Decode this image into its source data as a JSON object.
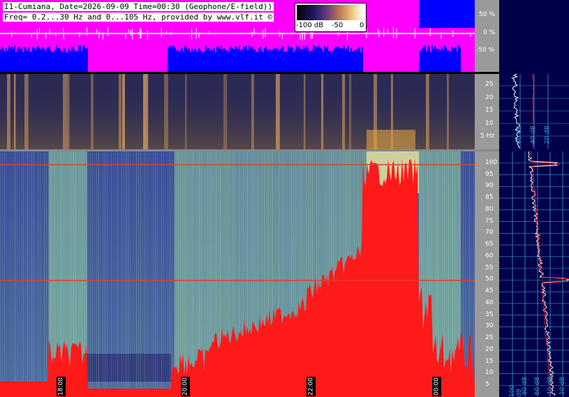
{
  "header": {
    "title_line1": "I1-Cumiana, Date=2026-09-09 Time=00:30 (Geophone/E-field))",
    "title_line2": "Freq= 0.2...30 Hz and 0...105 Hz, provided by www.vlf.it ©"
  },
  "colorbar": {
    "min_label": "-100 dB",
    "mid_label": "-50",
    "max_label": "0"
  },
  "top_panel": {
    "percent_labels": [
      "50 %",
      "0 %",
      "-50 %"
    ],
    "colors": {
      "background": "#ff00ff",
      "signal": "#0000ff",
      "baseline": "#ffffff"
    }
  },
  "middle_panel": {
    "freq_ticks": [
      "25",
      "20",
      "15",
      "10",
      "5 Hz"
    ]
  },
  "bottom_panel": {
    "freq_ticks": [
      "100",
      "95",
      "90",
      "85",
      "80",
      "75",
      "70",
      "65",
      "60",
      "55",
      "50",
      "45",
      "40",
      "35",
      "30",
      "25",
      "20",
      "15",
      "10",
      "5"
    ],
    "marker_lines_hz": [
      100,
      50
    ]
  },
  "time_labels": [
    "18:00",
    "20:00",
    "22:00",
    "00:00"
  ],
  "side_panel": {
    "bottom_axis_labels": [
      "100 dB",
      "80 dB",
      "60 dB",
      "40 dB",
      "20 dB"
    ],
    "middle_axis_labels": [
      "60 dB",
      "40 dB",
      "20 dB"
    ],
    "colors": {
      "background": "#00004a",
      "grid": "#3a9bd5",
      "curve_white": "#ffffff",
      "curve_red": "#ff2020"
    }
  }
}
